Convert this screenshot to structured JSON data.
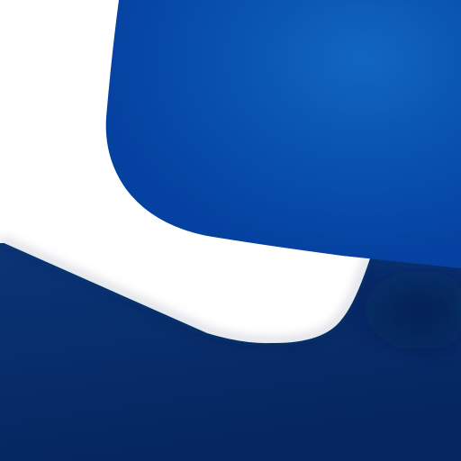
{
  "colors": {
    "background": "#ffffff",
    "navy_dark": "#05265f",
    "navy_mid": "#0a3577",
    "blue_card": "#0748a0",
    "blue_card_light": "#0a58b4",
    "blue_card_glow": "#1266c2",
    "white_card": "#ffffff"
  },
  "icons": {
    "white_card": "white-card-shape",
    "blue_card": "blue-card-shape",
    "background_panel": "navy-background-panel"
  }
}
